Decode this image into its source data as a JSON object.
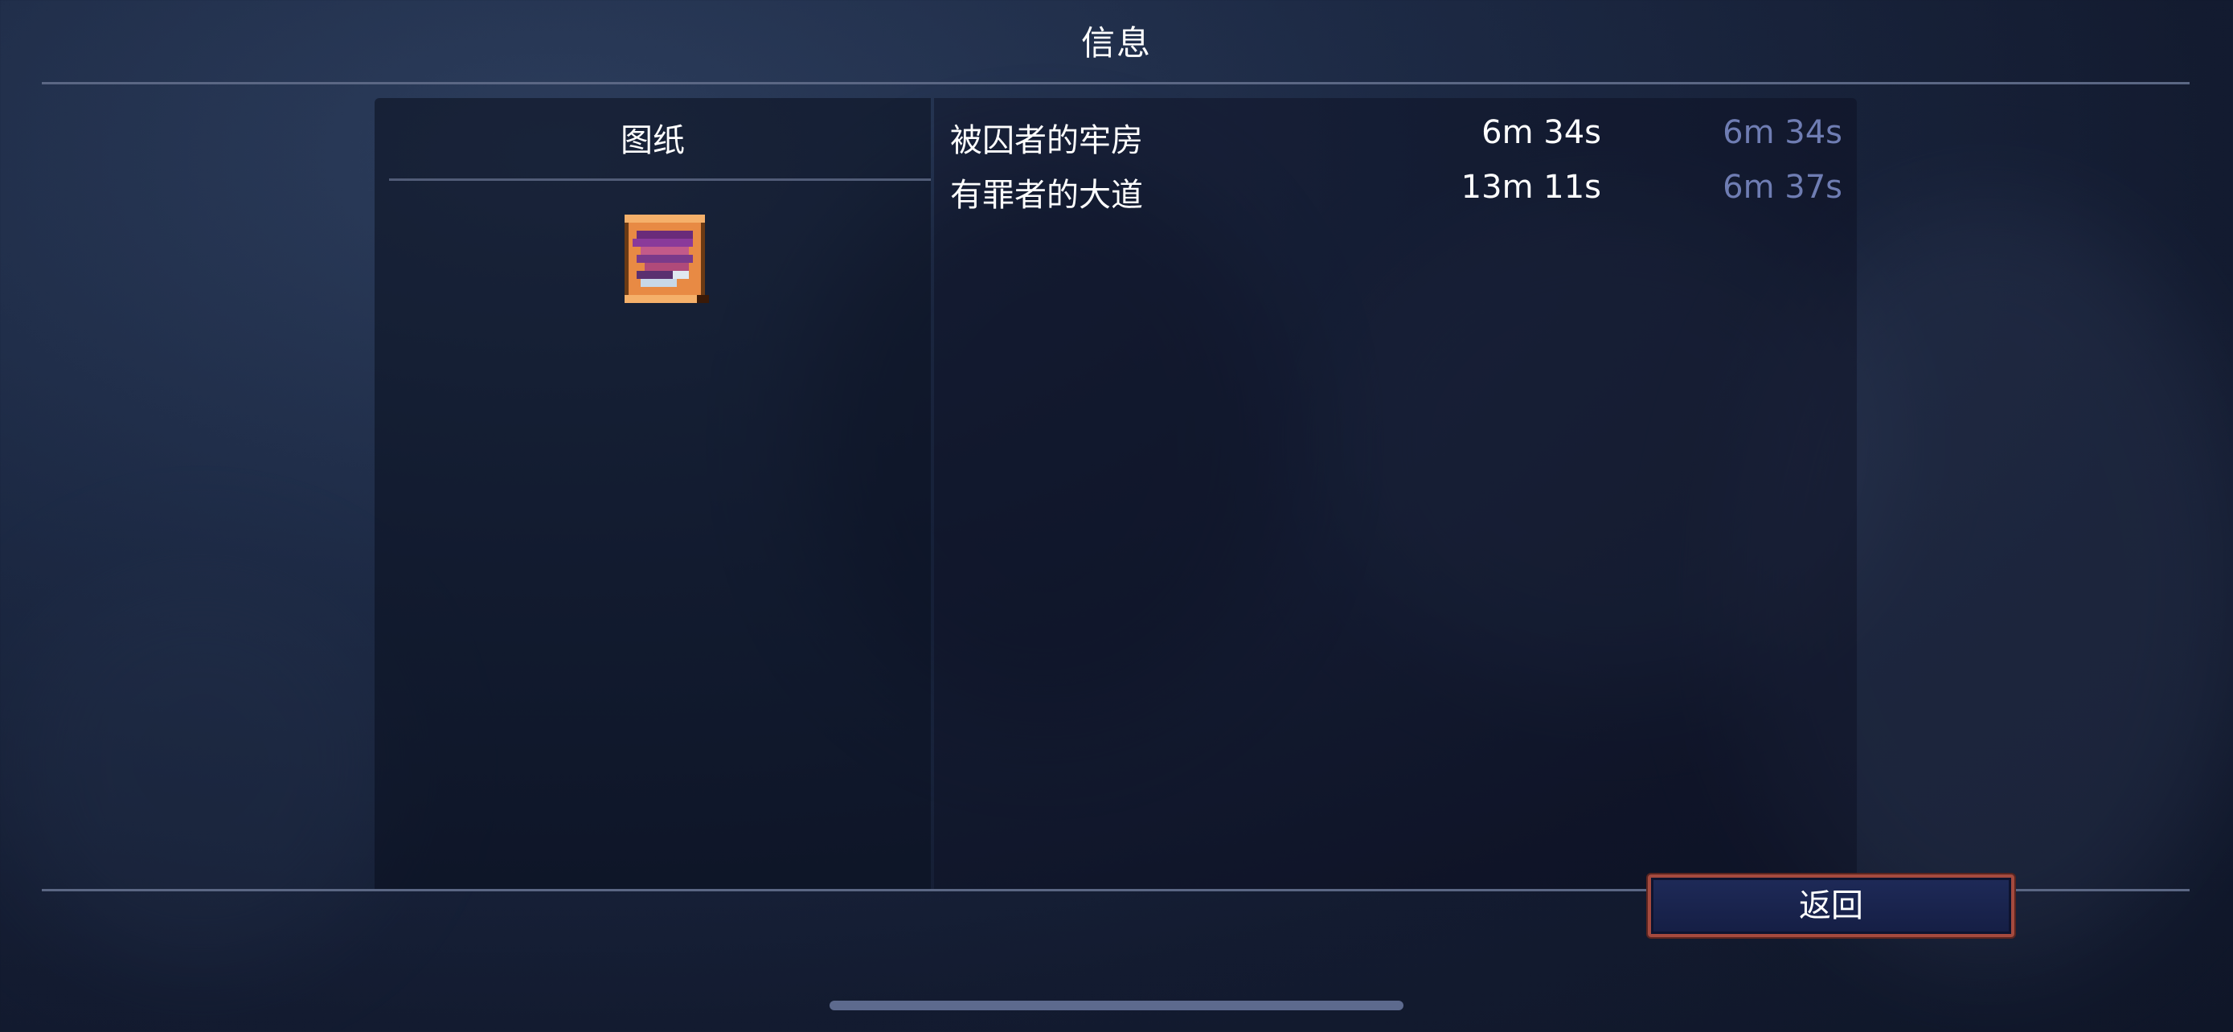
{
  "screen": {
    "title": "信息"
  },
  "left_panel": {
    "header": "图纸",
    "item_icon": "blueprint-scroll-icon"
  },
  "runs": [
    {
      "name": "被囚者的牢房",
      "total_time": "6m 34s",
      "split_time": "6m 34s"
    },
    {
      "name": "有罪者的大道",
      "total_time": "13m 11s",
      "split_time": "6m 37s"
    }
  ],
  "buttons": {
    "back_label": "返回"
  },
  "colors": {
    "accent_border": "#a54a3e",
    "split_time_text": "#6f7db3",
    "button_fill": "#1e2a58"
  }
}
